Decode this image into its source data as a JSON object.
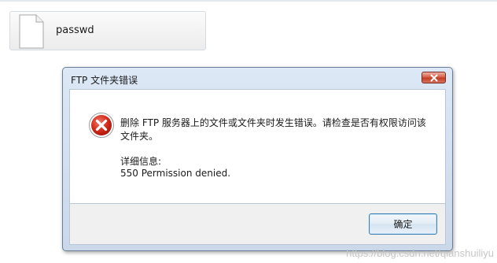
{
  "explorer": {
    "file_name": "passwd"
  },
  "dialog": {
    "title": "FTP 文件夹错误",
    "message": "删除 FTP 服务器上的文件或文件夹时发生错误。请检查是否有权限访问该文件夹。",
    "detail_label": "详细信息:",
    "detail_value": "550 Permission denied.",
    "ok_label": "确定",
    "icons": [
      "close-icon",
      "error-icon"
    ]
  },
  "watermark": "https://blog.csdn.net/qianshuiliyu"
}
